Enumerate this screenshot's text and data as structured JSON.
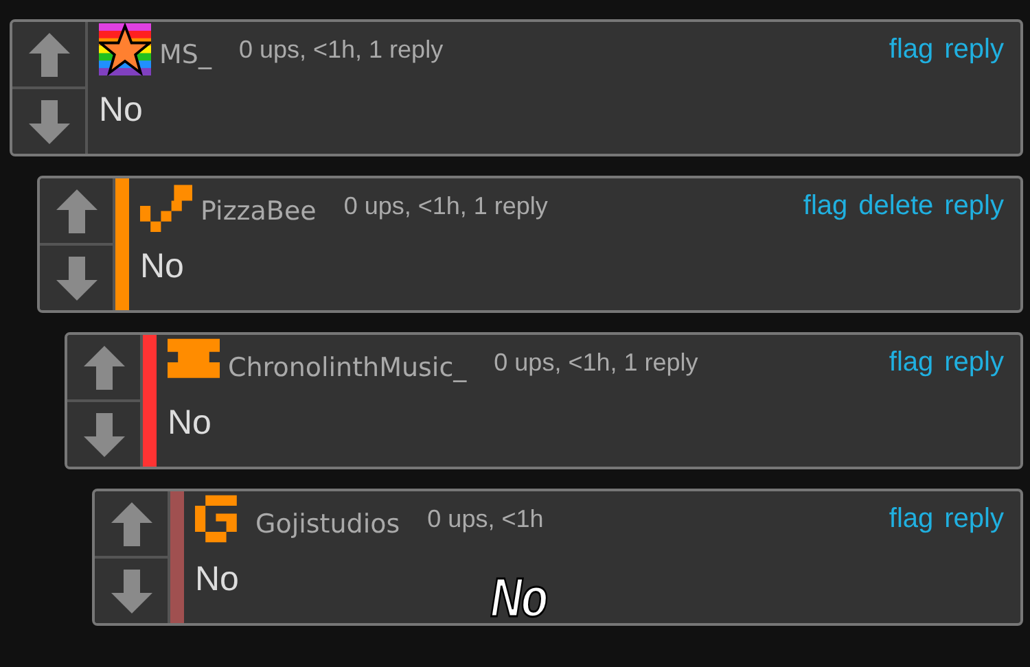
{
  "comments": [
    {
      "username": "MS_",
      "meta": "0 ups, <1h, 1 reply",
      "actions": [
        "flag",
        "reply"
      ],
      "text": "No",
      "children": [
        {
          "username": "PizzaBee",
          "meta": "0 ups, <1h, 1 reply",
          "actions": [
            "flag",
            "delete",
            "reply"
          ],
          "text": "No",
          "color": "#ff8c00",
          "children": [
            {
              "username": "ChronolinthMusic_",
              "meta": "0 ups, <1h, 1 reply",
              "actions": [
                "flag",
                "reply"
              ],
              "text": "No",
              "color": "#ff3333",
              "children": [
                {
                  "username": "Gojistudios",
                  "meta": "0 ups, <1h",
                  "actions": [
                    "flag",
                    "reply"
                  ],
                  "text": "No",
                  "color": "#a05050"
                }
              ]
            }
          ]
        }
      ]
    }
  ],
  "caption": "No"
}
